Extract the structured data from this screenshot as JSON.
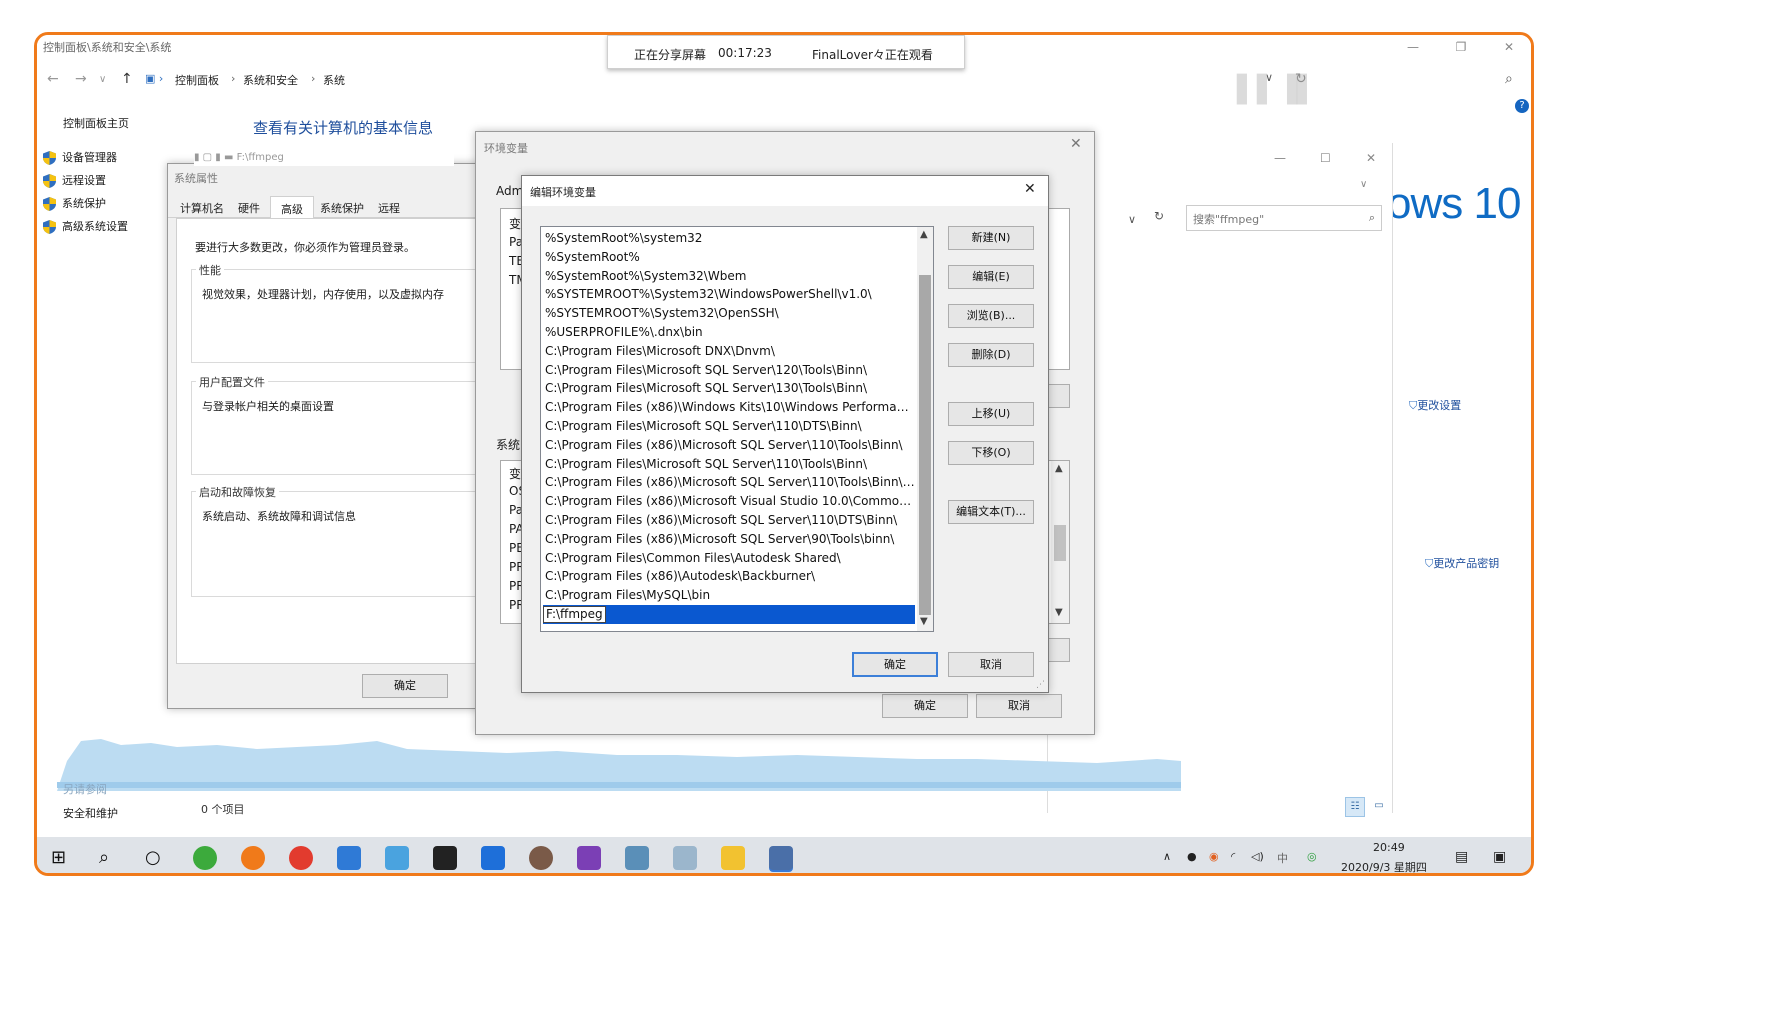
{
  "titlebar": {
    "path": "控制面板\\系统和安全\\系统"
  },
  "share": {
    "status": "正在分享屏幕",
    "timer": "00:17:23",
    "viewer": "FinalLover々正在观看"
  },
  "breadcrumb": {
    "a": "控制面板",
    "b": "系统和安全",
    "c": "系统"
  },
  "left_pane": {
    "home": "控制面板主页",
    "items": [
      "设备管理器",
      "远程设置",
      "系统保护",
      "高级系统设置"
    ],
    "see_also": "另请参阅",
    "security": "安全和维护"
  },
  "main": {
    "heading": "查看有关计算机的基本信息",
    "brand": "ows 10",
    "change_settings": "更改设置",
    "change_key": "更改产品密钥",
    "items_count": "0 个项目"
  },
  "explorer": {
    "path": "F:\\ffmpeg",
    "search_placeholder": "搜索\"ffmpeg\""
  },
  "sysprops": {
    "title": "系统属性",
    "tabs": [
      "计算机名",
      "硬件",
      "高级",
      "系统保护",
      "远程"
    ],
    "admin_note": "要进行大多数更改，你必须作为管理员登录。",
    "perf_label": "性能",
    "perf_desc": "视觉效果，处理器计划，内存使用，以及虚拟内存",
    "profile_label": "用户配置文件",
    "profile_desc": "与登录帐户相关的桌面设置",
    "startup_label": "启动和故障恢复",
    "startup_desc": "系统启动、系统故障和调试信息",
    "ok": "确定"
  },
  "envvars": {
    "title": "环境变量",
    "user_label": "Adm",
    "user_rows": [
      "变",
      "Pa",
      "TE",
      "TM"
    ],
    "sys_label": "系统",
    "sys_rows": [
      "变",
      "OS",
      "Pa",
      "PA",
      "PE",
      "PR",
      "PR",
      "PR"
    ],
    "ok": "确定",
    "cancel": "取消"
  },
  "editenv": {
    "title": "编辑环境变量",
    "entries": [
      "%SystemRoot%\\system32",
      "%SystemRoot%",
      "%SystemRoot%\\System32\\Wbem",
      "%SYSTEMROOT%\\System32\\WindowsPowerShell\\v1.0\\",
      "%SYSTEMROOT%\\System32\\OpenSSH\\",
      "%USERPROFILE%\\.dnx\\bin",
      "C:\\Program Files\\Microsoft DNX\\Dnvm\\",
      "C:\\Program Files\\Microsoft SQL Server\\120\\Tools\\Binn\\",
      "C:\\Program Files\\Microsoft SQL Server\\130\\Tools\\Binn\\",
      "C:\\Program Files (x86)\\Windows Kits\\10\\Windows Performance...",
      "C:\\Program Files\\Microsoft SQL Server\\110\\DTS\\Binn\\",
      "C:\\Program Files (x86)\\Microsoft SQL Server\\110\\Tools\\Binn\\",
      "C:\\Program Files\\Microsoft SQL Server\\110\\Tools\\Binn\\",
      "C:\\Program Files (x86)\\Microsoft SQL Server\\110\\Tools\\Binn\\M...",
      "C:\\Program Files (x86)\\Microsoft Visual Studio 10.0\\Common7\\...",
      "C:\\Program Files (x86)\\Microsoft SQL Server\\110\\DTS\\Binn\\",
      "C:\\Program Files (x86)\\Microsoft SQL Server\\90\\Tools\\binn\\",
      "C:\\Program Files\\Common Files\\Autodesk Shared\\",
      "C:\\Program Files (x86)\\Autodesk\\Backburner\\",
      "C:\\Program Files\\MySQL\\bin"
    ],
    "editing_value": "F:\\ffmpeg",
    "buttons": {
      "new": "新建(N)",
      "edit": "编辑(E)",
      "browse": "浏览(B)...",
      "delete": "删除(D)",
      "up": "上移(U)",
      "down": "下移(O)",
      "edit_text": "编辑文本(T)..."
    },
    "ok": "确定",
    "cancel": "取消"
  },
  "taskbar": {
    "time": "20:49",
    "date": "2020/9/3 星期四"
  },
  "colors": {
    "accent_border": "#f07a1a",
    "selection": "#0a58d0",
    "link": "#1e4e9c"
  }
}
